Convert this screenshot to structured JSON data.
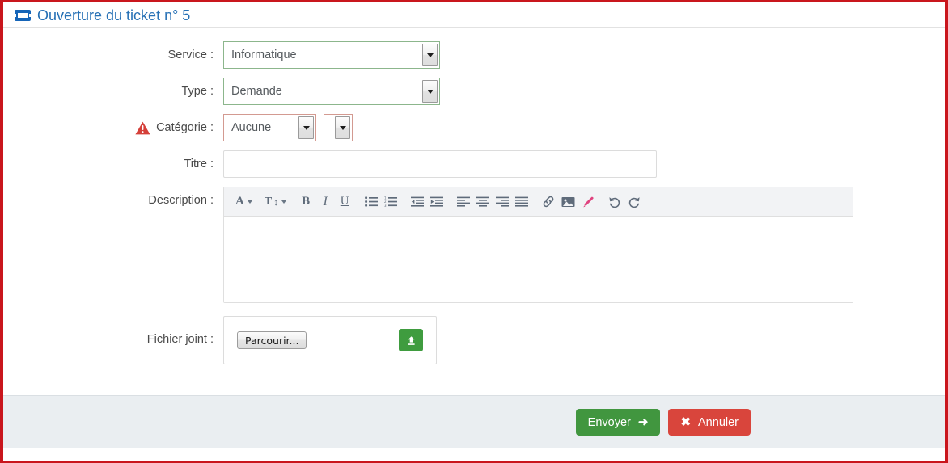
{
  "window": {
    "title": "Ouverture du ticket n° 5",
    "title_icon": "ticket-icon",
    "border_color": "#c9161d",
    "title_color": "#2670b5"
  },
  "form": {
    "service": {
      "label": "Service :",
      "value": "Informatique",
      "border_color": "#8cb68c"
    },
    "type": {
      "label": "Type :",
      "value": "Demande",
      "border_color": "#8cb68c"
    },
    "categorie": {
      "label": "Catégorie :",
      "value": "Aucune",
      "secondary_value": "",
      "border_color": "#d39a91",
      "warning_icon": "warning-triangle-icon",
      "warning_color": "#d9453c"
    },
    "titre": {
      "label": "Titre :",
      "value": "",
      "placeholder": ""
    },
    "description": {
      "label": "Description :",
      "value": "",
      "toolbar": [
        {
          "name": "font-family-icon",
          "glyph": "A",
          "caret": true
        },
        {
          "name": "font-size-icon",
          "glyph": "T↕",
          "caret": true
        },
        {
          "name": "bold-icon",
          "glyph": "B",
          "caret": false
        },
        {
          "name": "italic-icon",
          "glyph": "I",
          "caret": false
        },
        {
          "name": "underline-icon",
          "glyph": "U",
          "caret": false
        },
        {
          "name": "unordered-list-icon",
          "glyph": "",
          "caret": false
        },
        {
          "name": "ordered-list-icon",
          "glyph": "",
          "caret": false
        },
        {
          "name": "outdent-icon",
          "glyph": "",
          "caret": false
        },
        {
          "name": "indent-icon",
          "glyph": "",
          "caret": false
        },
        {
          "name": "align-left-icon",
          "glyph": "",
          "caret": false
        },
        {
          "name": "align-center-icon",
          "glyph": "",
          "caret": false
        },
        {
          "name": "align-right-icon",
          "glyph": "",
          "caret": false
        },
        {
          "name": "align-justify-icon",
          "glyph": "",
          "caret": false
        },
        {
          "name": "link-icon",
          "glyph": "",
          "caret": false
        },
        {
          "name": "image-icon",
          "glyph": "",
          "caret": false
        },
        {
          "name": "highlighter-icon",
          "glyph": "",
          "caret": false
        },
        {
          "name": "undo-icon",
          "glyph": "",
          "caret": false
        },
        {
          "name": "redo-icon",
          "glyph": "",
          "caret": false
        }
      ]
    },
    "fichier_joint": {
      "label": "Fichier joint :",
      "browse_label": "Parcourir...",
      "upload_icon": "upload-icon",
      "upload_color": "#3f9c3f"
    }
  },
  "footer": {
    "send_label": "Envoyer",
    "send_icon": "arrow-right-icon",
    "send_color": "#41963f",
    "cancel_label": "Annuler",
    "cancel_icon": "close-x-icon",
    "cancel_color": "#d9453c"
  }
}
